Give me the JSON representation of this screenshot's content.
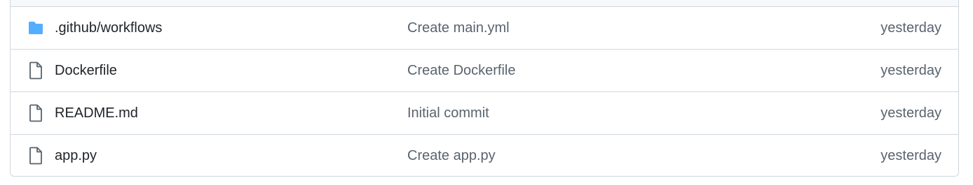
{
  "colors": {
    "folder_icon": "#54aeff",
    "file_icon": "#59636e",
    "name_text": "#1f2328",
    "muted_text": "#59636e",
    "border": "#d0d7de"
  },
  "files": [
    {
      "type": "folder",
      "icon": "folder-icon",
      "name": ".github/workflows",
      "message": "Create main.yml",
      "date": "yesterday"
    },
    {
      "type": "file",
      "icon": "file-icon",
      "name": "Dockerfile",
      "message": "Create Dockerfile",
      "date": "yesterday"
    },
    {
      "type": "file",
      "icon": "file-icon",
      "name": "README.md",
      "message": "Initial commit",
      "date": "yesterday"
    },
    {
      "type": "file",
      "icon": "file-icon",
      "name": "app.py",
      "message": "Create app.py",
      "date": "yesterday"
    }
  ]
}
